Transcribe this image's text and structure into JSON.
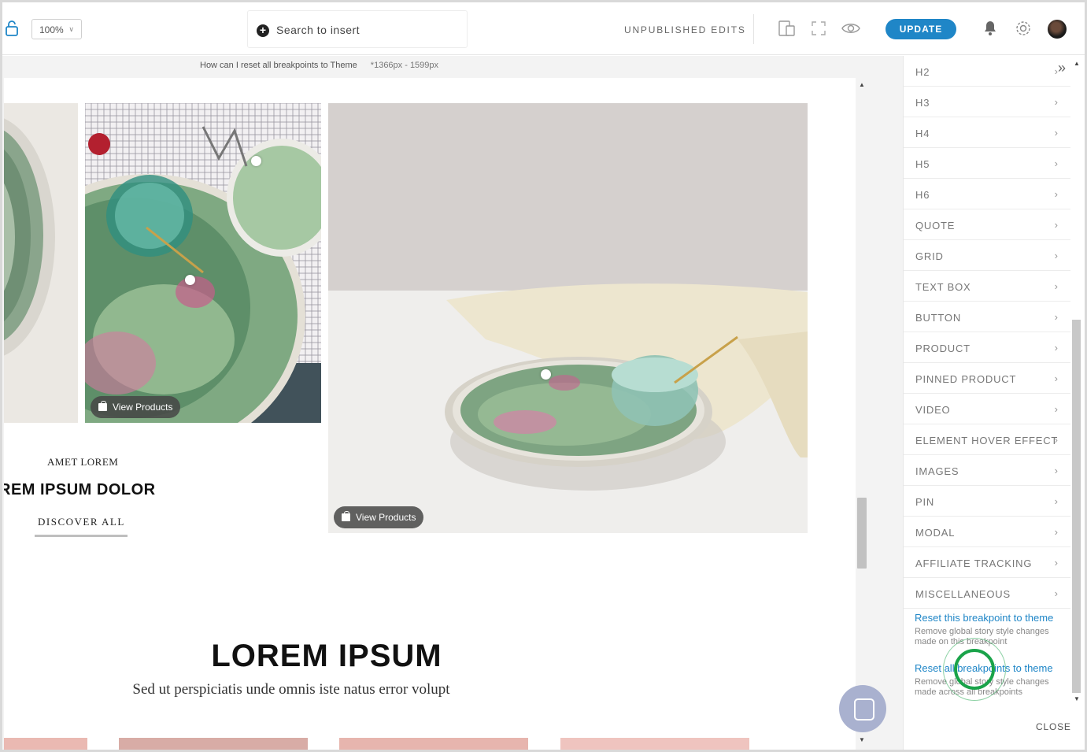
{
  "toolbar": {
    "zoom": "100%",
    "search_placeholder": "Search to insert",
    "status": "UNPUBLISHED EDITS",
    "update_label": "UPDATE",
    "icons": [
      "lock-icon",
      "plus-circle-icon",
      "device-switch-icon",
      "fullscreen-icon",
      "eye-icon",
      "bell-icon",
      "gear-icon",
      "avatar"
    ]
  },
  "canvas": {
    "info_text": "How can I reset all breakpoints to Theme",
    "breakpoint": "*1366px - 1599px",
    "view_products": "View Products",
    "eyebrow": "AMET LOREM",
    "heading_partial": "REM IPSUM DOLOR",
    "discover": "DISCOVER ALL",
    "big_title": "LOREM IPSUM",
    "subtitle": "Sed ut perspiciatis unde omnis iste natus error volupt"
  },
  "panel": {
    "items": [
      {
        "label": "H2"
      },
      {
        "label": "H3"
      },
      {
        "label": "H4"
      },
      {
        "label": "H5"
      },
      {
        "label": "H6"
      },
      {
        "label": "QUOTE"
      },
      {
        "label": "GRID"
      },
      {
        "label": "TEXT BOX"
      },
      {
        "label": "BUTTON"
      },
      {
        "label": "PRODUCT"
      },
      {
        "label": "PINNED PRODUCT"
      },
      {
        "label": "VIDEO"
      },
      {
        "label": "ELEMENT HOVER EFFECT"
      },
      {
        "label": "IMAGES"
      },
      {
        "label": "PIN"
      },
      {
        "label": "MODAL"
      },
      {
        "label": "AFFILIATE TRACKING"
      },
      {
        "label": "MISCELLANEOUS"
      }
    ],
    "reset_this": "Reset this breakpoint to theme",
    "reset_this_desc": "Remove global story style changes made on this breakpoint",
    "reset_all": "Reset all breakpoints to theme",
    "reset_all_desc": "Remove global story style changes made across all breakpoints",
    "close": "CLOSE"
  },
  "colors": {
    "accent": "#1f86c7",
    "highlight_ring": "#1aa34a"
  }
}
